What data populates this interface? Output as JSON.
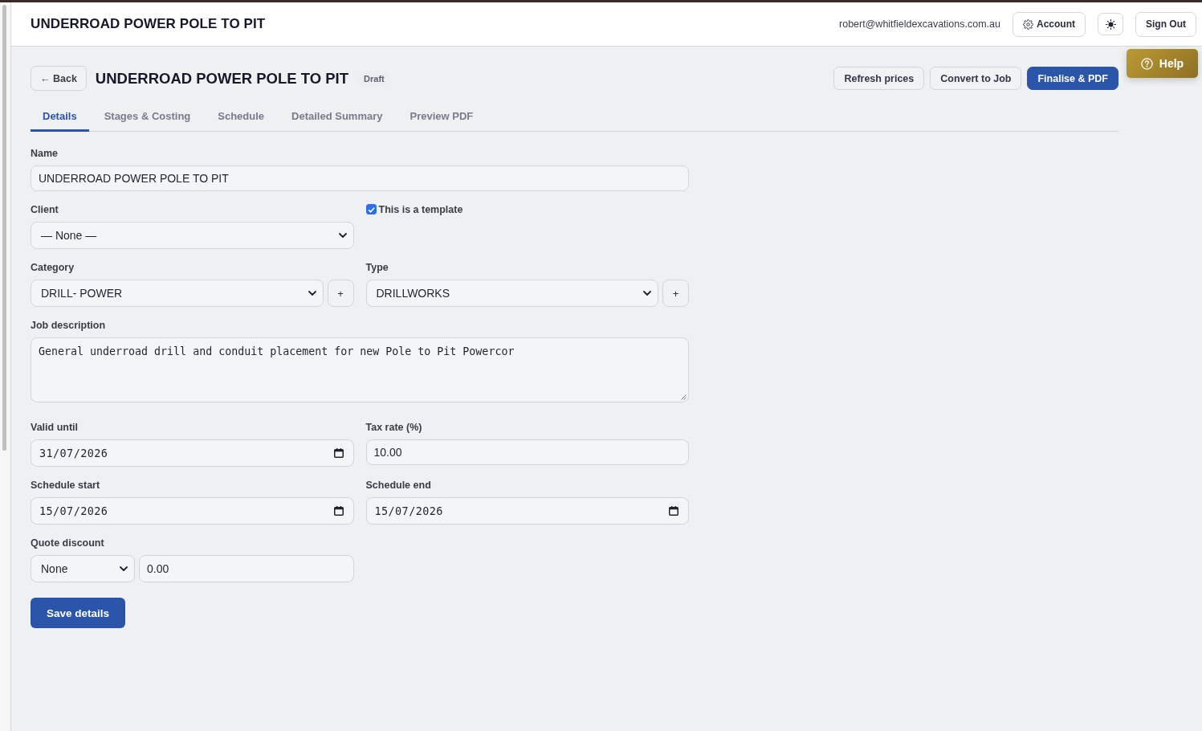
{
  "header": {
    "title": "UNDERROAD POWER POLE TO PIT",
    "email": "robert@whitfieldexcavations.com.au",
    "account_button": "Account",
    "sign_out_button": "Sign Out"
  },
  "help_button": "Help",
  "toolbar": {
    "back_button": "← Back",
    "title": "UNDERROAD POWER POLE TO PIT",
    "status_badge": "Draft",
    "actions": [
      {
        "label": "Refresh prices",
        "kind": "secondary"
      },
      {
        "label": "Convert to Job",
        "kind": "secondary"
      },
      {
        "label": "Finalise & PDF",
        "kind": "primary"
      }
    ]
  },
  "tabs": [
    {
      "label": "Details",
      "selected": true
    },
    {
      "label": "Stages & Costing",
      "selected": false
    },
    {
      "label": "Schedule",
      "selected": false
    },
    {
      "label": "Detailed Summary",
      "selected": false
    },
    {
      "label": "Preview PDF",
      "selected": false
    }
  ],
  "form": {
    "name": {
      "label": "Name",
      "value": "UNDERROAD POWER POLE TO PIT"
    },
    "client": {
      "label": "Client",
      "value": "— None —"
    },
    "template": {
      "label": "This is a template",
      "checked": true
    },
    "category": {
      "label": "Category",
      "value": "DRILL- POWER",
      "add_button": "+"
    },
    "type": {
      "label": "Type",
      "value": "DRILLWORKS",
      "add_button": "+"
    },
    "job_description": {
      "label": "Job description",
      "value": "General underroad drill and conduit placement for new Pole to Pit Powercor"
    },
    "valid_until": {
      "label": "Valid until",
      "value": "31/07/2026"
    },
    "tax_rate": {
      "label": "Tax rate (%)",
      "value": "10.00"
    },
    "schedule_start": {
      "label": "Schedule start",
      "value": "15/07/2026"
    },
    "schedule_end": {
      "label": "Schedule end",
      "value": "15/07/2026"
    },
    "quote_discount": {
      "label": "Quote discount",
      "mode": "None",
      "amount": "0.00"
    },
    "save_button": "Save details"
  }
}
